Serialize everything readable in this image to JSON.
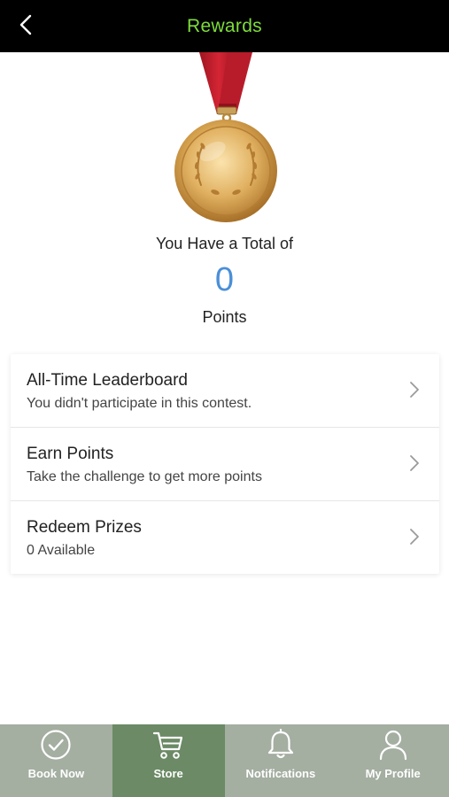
{
  "header": {
    "title": "Rewards",
    "title_color": "#7ddc3a"
  },
  "summary": {
    "total_label": "You Have a Total of",
    "points_value": "0",
    "points_label": "Points",
    "points_color": "#4a8fd8"
  },
  "menu": [
    {
      "title": "All-Time Leaderboard",
      "subtitle": "You didn't participate in this contest."
    },
    {
      "title": "Earn Points",
      "subtitle": "Take the challenge to get more points"
    },
    {
      "title": "Redeem Prizes",
      "subtitle": "0 Available"
    }
  ],
  "tabs": [
    {
      "label": "Book Now",
      "icon": "check-circle-icon",
      "active": false
    },
    {
      "label": "Store",
      "icon": "cart-icon",
      "active": true
    },
    {
      "label": "Notifications",
      "icon": "bell-icon",
      "active": false
    },
    {
      "label": "My Profile",
      "icon": "user-icon",
      "active": false
    }
  ],
  "colors": {
    "tabbar_bg": "#a4aea1",
    "tab_active_bg": "#6b8a65",
    "medal_gold": "#c88d3c",
    "ribbon_red": "#c41d2b"
  }
}
